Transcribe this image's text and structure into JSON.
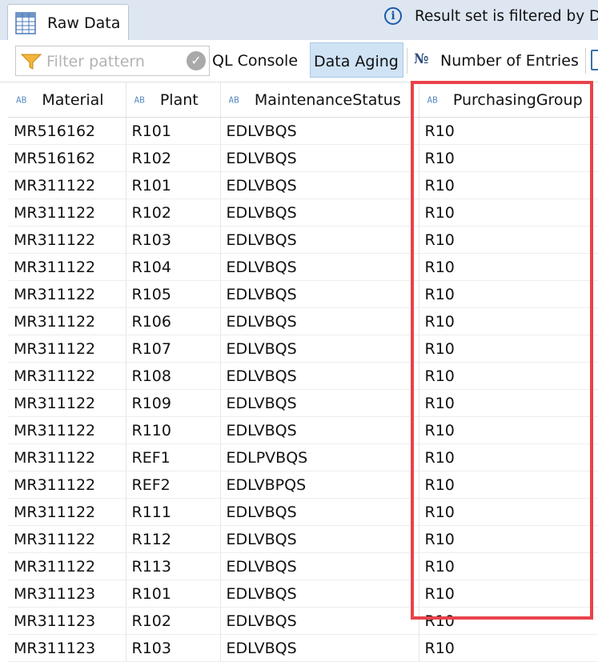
{
  "tabs": {
    "active_label": "Raw Data"
  },
  "info_bar": {
    "icon": "info-icon",
    "message": "Result set is filtered by D"
  },
  "toolbar": {
    "filter_placeholder": "Filter pattern",
    "sql_console_label": "QL Console",
    "data_aging_label": "Data Aging",
    "number_of_entries_label": "Number of Entries",
    "number_icon": "№"
  },
  "table": {
    "columns": [
      {
        "type_badge": "AB",
        "label": "Material"
      },
      {
        "type_badge": "AB",
        "label": "Plant"
      },
      {
        "type_badge": "AB",
        "label": "MaintenanceStatus"
      },
      {
        "type_badge": "AB",
        "label": "PurchasingGroup"
      }
    ],
    "rows": [
      [
        "MR516162",
        "R101",
        "EDLVBQS",
        "R10"
      ],
      [
        "MR516162",
        "R102",
        "EDLVBQS",
        "R10"
      ],
      [
        "MR311122",
        "R101",
        "EDLVBQS",
        "R10"
      ],
      [
        "MR311122",
        "R102",
        "EDLVBQS",
        "R10"
      ],
      [
        "MR311122",
        "R103",
        "EDLVBQS",
        "R10"
      ],
      [
        "MR311122",
        "R104",
        "EDLVBQS",
        "R10"
      ],
      [
        "MR311122",
        "R105",
        "EDLVBQS",
        "R10"
      ],
      [
        "MR311122",
        "R106",
        "EDLVBQS",
        "R10"
      ],
      [
        "MR311122",
        "R107",
        "EDLVBQS",
        "R10"
      ],
      [
        "MR311122",
        "R108",
        "EDLVBQS",
        "R10"
      ],
      [
        "MR311122",
        "R109",
        "EDLVBQS",
        "R10"
      ],
      [
        "MR311122",
        "R110",
        "EDLVBQS",
        "R10"
      ],
      [
        "MR311122",
        "REF1",
        "EDLPVBQS",
        "R10"
      ],
      [
        "MR311122",
        "REF2",
        "EDLVBPQS",
        "R10"
      ],
      [
        "MR311122",
        "R111",
        "EDLVBQS",
        "R10"
      ],
      [
        "MR311122",
        "R112",
        "EDLVBQS",
        "R10"
      ],
      [
        "MR311122",
        "R113",
        "EDLVBQS",
        "R10"
      ],
      [
        "MR311123",
        "R101",
        "EDLVBQS",
        "R10"
      ],
      [
        "MR311123",
        "R102",
        "EDLVBQS",
        "R10"
      ],
      [
        "MR311123",
        "R103",
        "EDLVBQS",
        "R10"
      ]
    ]
  },
  "colors": {
    "highlight_border": "#e8434b",
    "active_button_bg": "#cfe3f5",
    "tabstrip_bg": "#dde6f1"
  }
}
